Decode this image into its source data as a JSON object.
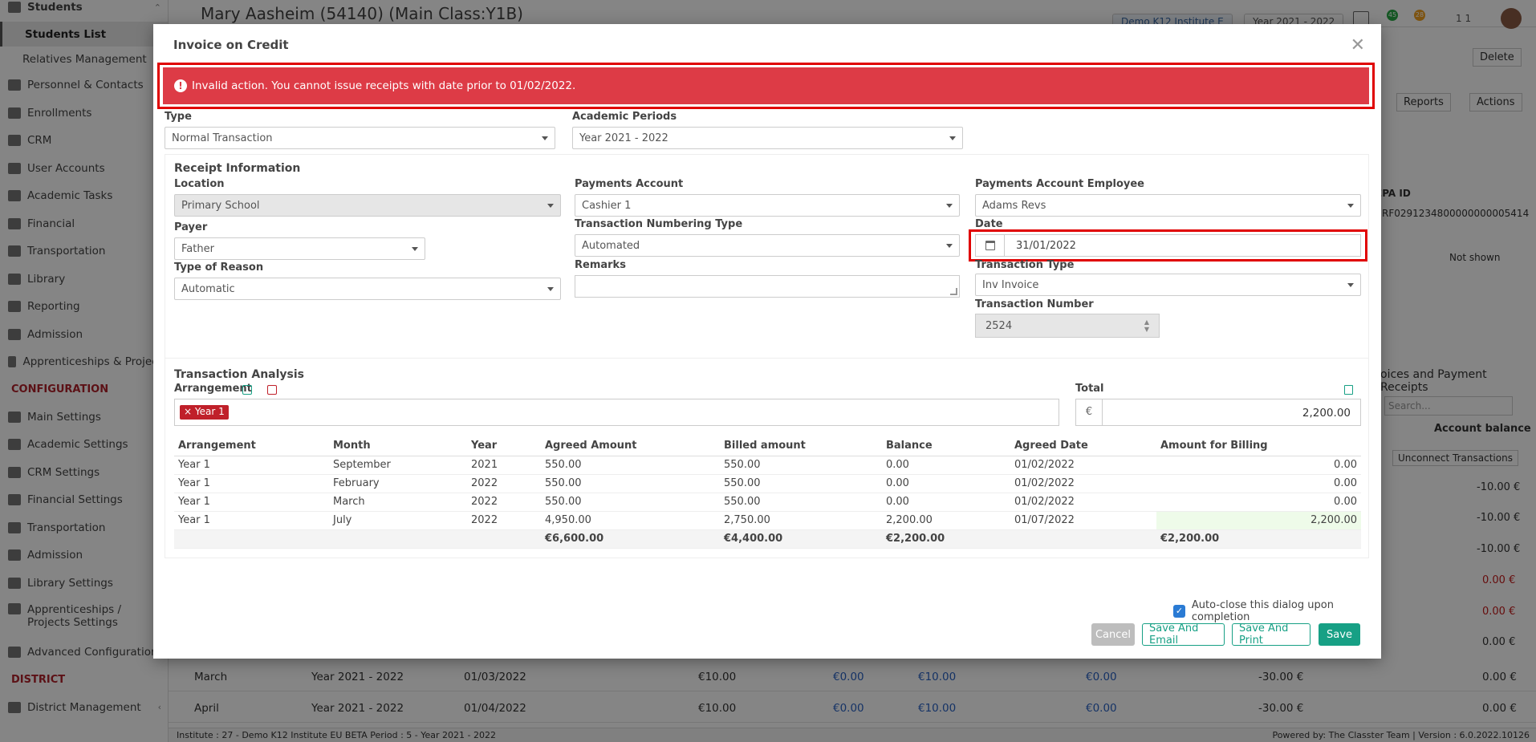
{
  "sidebar": {
    "top_item": "Students",
    "sub_items": [
      "Students List",
      "Relatives Management"
    ],
    "items": [
      "Personnel & Contacts",
      "Enrollments",
      "CRM",
      "User Accounts",
      "Academic Tasks",
      "Financial",
      "Transportation",
      "Library",
      "Reporting",
      "Admission",
      "Apprenticeships & Projects"
    ],
    "config_header": "CONFIGURATION",
    "config_items": [
      "Main Settings",
      "Academic Settings",
      "CRM Settings",
      "Financial Settings",
      "Transportation",
      "Admission",
      "Library Settings",
      "Apprenticeships / Projects Settings",
      "Advanced Configurations"
    ],
    "district_header": "DISTRICT",
    "district_items": [
      "District Management"
    ]
  },
  "topbar": {
    "title": "Mary Aasheim (54140) (Main Class:Y1B)",
    "institute_pill": "Demo K12 Institute E",
    "year_pill": "Year 2021 - 2022",
    "badge1": "45",
    "badge2": "28",
    "user_count": "1 1"
  },
  "background": {
    "delete_label": "Delete",
    "reports_label": "Reports",
    "actions_label": "Actions",
    "sepa_label": "EPA ID",
    "sepa_value": "RF0291234800000000005414",
    "not_shown": "Not shown",
    "invoices_header": "oices and Payment Receipts",
    "search_placeholder": "Search...",
    "account_balance": "Account balance",
    "unconnect": "Unconnect Transactions",
    "balances": [
      "-10.00 €",
      "-10.00 €",
      "-10.00 €",
      "0.00 €",
      "0.00 €",
      "0.00 €"
    ],
    "rows": [
      {
        "month": "March",
        "year": "Year 2021 - 2022",
        "date": "01/03/2022",
        "amt": "€10.00",
        "a": "€0.00",
        "b": "€10.00",
        "c": "€0.00",
        "d": "-30.00 €",
        "e": "0.00 €"
      },
      {
        "month": "April",
        "year": "Year 2021 - 2022",
        "date": "01/04/2022",
        "amt": "€10.00",
        "a": "€0.00",
        "b": "€10.00",
        "c": "€0.00",
        "d": "-30.00 €",
        "e": "0.00 €"
      }
    ]
  },
  "footer": {
    "left": "Institute : 27 - Demo K12 Institute EU BETA  Period : 5 - Year 2021 - 2022",
    "right": "Powered by: The Classter Team | Version : 6.0.2022.10126"
  },
  "modal": {
    "title": "Invoice on Credit",
    "alert": "Invalid action. You cannot issue receipts with date prior to 01/02/2022.",
    "type_label": "Type",
    "type_value": "Normal Transaction",
    "periods_label": "Academic Periods",
    "periods_value": "Year 2021 - 2022",
    "receipt_info": "Receipt Information",
    "location_label": "Location",
    "location_value": "Primary School",
    "payer_label": "Payer",
    "payer_value": "Father",
    "reason_label": "Type of Reason",
    "reason_value": "Automatic",
    "account_label": "Payments Account",
    "account_value": "Cashier 1",
    "numbering_label": "Transaction Numbering Type",
    "numbering_value": "Automated",
    "remarks_label": "Remarks",
    "employee_label": "Payments Account Employee",
    "employee_value": "Adams Revs",
    "date_label": "Date",
    "date_value": "31/01/2022",
    "ttype_label": "Transaction Type",
    "ttype_value": "Inv Invoice",
    "tnumber_label": "Transaction Number",
    "tnumber_value": "2524",
    "analysis_header": "Transaction Analysis",
    "arrangement_label": "Arrangement",
    "tag_value": "Year 1",
    "total_label": "Total",
    "currency": "€",
    "total_value": "2,200.00",
    "table": {
      "headers": [
        "Arrangement",
        "Month",
        "Year",
        "Agreed Amount",
        "Billed amount",
        "Balance",
        "Agreed Date",
        "Amount for Billing"
      ],
      "rows": [
        [
          "Year 1",
          "September",
          "2021",
          "550.00",
          "550.00",
          "0.00",
          "01/02/2022",
          "0.00"
        ],
        [
          "Year 1",
          "February",
          "2022",
          "550.00",
          "550.00",
          "0.00",
          "01/02/2022",
          "0.00"
        ],
        [
          "Year 1",
          "March",
          "2022",
          "550.00",
          "550.00",
          "0.00",
          "01/02/2022",
          "0.00"
        ],
        [
          "Year 1",
          "July",
          "2022",
          "4,950.00",
          "2,750.00",
          "2,200.00",
          "01/07/2022",
          "2,200.00"
        ]
      ],
      "totals": [
        "",
        "",
        "",
        "€6,600.00",
        "€4,400.00",
        "€2,200.00",
        "",
        "€2,200.00"
      ]
    },
    "auto_close": "Auto-close this dialog upon completion",
    "cancel": "Cancel",
    "save_email": "Save And Email",
    "save_print": "Save And Print",
    "save": "Save"
  }
}
